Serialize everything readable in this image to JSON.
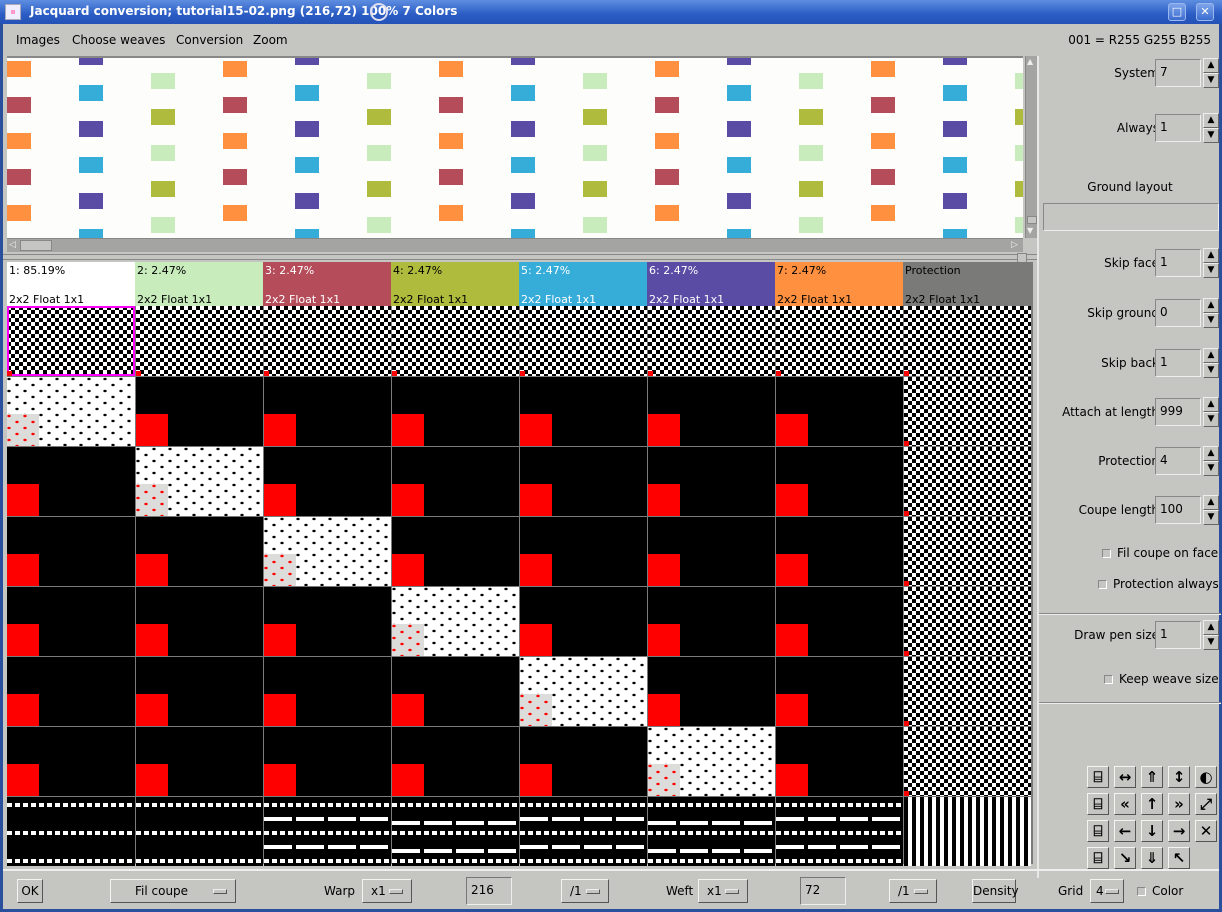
{
  "window": {
    "title": "Jacquard conversion; tutorial15-02.png (216,72) 100% 7 Colors",
    "maximize_icon": "maximize-icon",
    "close_icon": "close-icon",
    "close_glyph": "✕",
    "maximize_glyph": "□"
  },
  "menu": {
    "items": [
      "Images",
      "Choose weaves",
      "Conversion",
      "Zoom"
    ],
    "status": "001 = R255 G255 B255"
  },
  "colors": {
    "c1": "#ffffff",
    "c2": "#c8ecbc",
    "c3": "#b44c5a",
    "c4": "#aebb3c",
    "c5": "#36acd8",
    "c6": "#5a4ca4",
    "c7": "#ff9040",
    "protection": "#7a7b78",
    "selection": "#ff00ff",
    "red": "#ff0000"
  },
  "columns": [
    {
      "pct": "1: 85.19%",
      "weave": "2x2 Float 1x1",
      "color": "#ffffff",
      "text": "#000000"
    },
    {
      "pct": "2: 2.47%",
      "weave": "2x2 Float 1x1",
      "color": "#c8ecbc",
      "text": "#000000"
    },
    {
      "pct": "3: 2.47%",
      "weave": "2x2 Float 1x1",
      "color": "#b44c5a",
      "text": "#ffffff"
    },
    {
      "pct": "4: 2.47%",
      "weave": "2x2 Float 1x1",
      "color": "#aebb3c",
      "text": "#000000"
    },
    {
      "pct": "5: 2.47%",
      "weave": "2x2 Float 1x1",
      "color": "#36acd8",
      "text": "#ffffff"
    },
    {
      "pct": "6: 2.47%",
      "weave": "2x2 Float 1x1",
      "color": "#5a4ca4",
      "text": "#ffffff"
    },
    {
      "pct": "7: 2.47%",
      "weave": "2x2 Float 1x1",
      "color": "#ff9040",
      "text": "#000000"
    },
    {
      "pct": "Protection",
      "weave": "2x2 Float 1x1",
      "color": "#7a7b78",
      "text": "#000000"
    }
  ],
  "sidebar": {
    "system": {
      "label": "System",
      "value": "7"
    },
    "always": {
      "label": "Always",
      "value": "1"
    },
    "ground_layout": {
      "label": "Ground layout",
      "value": ""
    },
    "skip_face": {
      "label": "Skip face",
      "value": "1"
    },
    "skip_ground": {
      "label": "Skip ground",
      "value": "0"
    },
    "skip_back": {
      "label": "Skip back",
      "value": "1"
    },
    "attach_length": {
      "label": "Attach at length",
      "value": "999"
    },
    "protection": {
      "label": "Protection",
      "value": "4"
    },
    "coupe_length": {
      "label": "Coupe length",
      "value": "100"
    },
    "fil_coupe_on_face": {
      "label": "Fil coupe on face",
      "checked": false
    },
    "protection_always": {
      "label": "Protection always",
      "checked": false
    },
    "draw_pen_size": {
      "label": "Draw pen size",
      "value": "1"
    },
    "keep_weave_size": {
      "label": "Keep weave size",
      "checked": false
    },
    "tools": [
      {
        "name": "stairs-up-icon",
        "glyph": "⌸"
      },
      {
        "name": "move-horizontal-icon",
        "glyph": "↔"
      },
      {
        "name": "double-up-icon",
        "glyph": "⇑"
      },
      {
        "name": "move-vertical-icon",
        "glyph": "↕"
      },
      {
        "name": "invert-icon",
        "glyph": "◐"
      },
      {
        "name": "stairs-down-icon",
        "glyph": "⌸"
      },
      {
        "name": "double-left-icon",
        "glyph": "«"
      },
      {
        "name": "arrow-up-icon",
        "glyph": "↑"
      },
      {
        "name": "double-right-icon",
        "glyph": "»"
      },
      {
        "name": "mirror-diagonal-icon",
        "glyph": "⤢"
      },
      {
        "name": "stairs-right-icon",
        "glyph": "⌸"
      },
      {
        "name": "arrow-left-icon",
        "glyph": "←"
      },
      {
        "name": "arrow-down-icon",
        "glyph": "↓"
      },
      {
        "name": "arrow-right-icon",
        "glyph": "→"
      },
      {
        "name": "clear-icon",
        "glyph": "✕"
      },
      {
        "name": "stairs-left-icon",
        "glyph": "⌸"
      },
      {
        "name": "shift-down-right-icon",
        "glyph": "↘"
      },
      {
        "name": "double-down-icon",
        "glyph": "⇓"
      },
      {
        "name": "shift-up-left-icon",
        "glyph": "↖"
      }
    ]
  },
  "bottom": {
    "ok": "OK",
    "mode": "Fil coupe",
    "warp_label": "Warp",
    "warp_mult": "x1",
    "warp_value": "216",
    "warp_div": "/1",
    "weft_label": "Weft",
    "weft_mult": "x1",
    "weft_value": "72",
    "weft_div": "/1",
    "density": "Density",
    "grid_label": "Grid",
    "grid_value": "4",
    "color_label": "Color",
    "color_checked": false
  }
}
